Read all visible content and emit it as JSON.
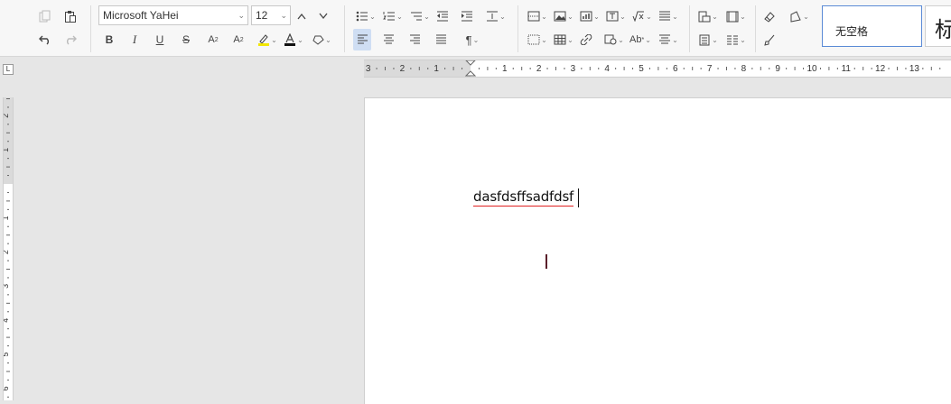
{
  "toolbar": {
    "font_name": "Microsoft YaHei",
    "font_size": "12",
    "style_no_spacing": "无空格",
    "style_heading_preview": "标"
  },
  "ruler": {
    "h_labels": [
      "3",
      "2",
      "1",
      "1",
      "2",
      "3",
      "4",
      "5",
      "6",
      "7",
      "8",
      "9",
      "10",
      "11",
      "12",
      "13"
    ],
    "v_labels": [
      "2",
      "1",
      "1",
      "2",
      "3",
      "4",
      "5",
      "6"
    ]
  },
  "document": {
    "text": "dasfdsffsadfdsf"
  },
  "icons": {
    "copy": "copy-icon",
    "paste": "paste-icon",
    "undo": "undo-icon",
    "redo": "redo-icon",
    "bold": "bold-icon",
    "italic": "italic-icon",
    "underline": "underline-icon",
    "strike": "strikethrough-icon",
    "superscript": "superscript-icon",
    "subscript": "subscript-icon",
    "highlight": "highlight-icon",
    "font_color": "font-color-icon",
    "clear_format": "clear-format-icon"
  }
}
